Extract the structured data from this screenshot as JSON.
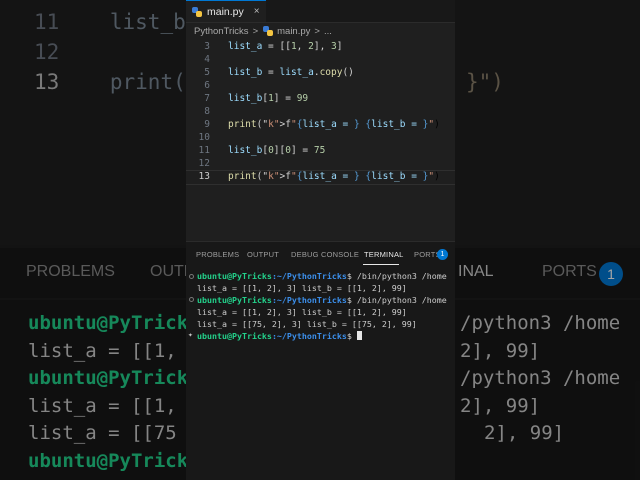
{
  "editor": {
    "tab_label": "main.py",
    "tab_close": "×",
    "breadcrumb": {
      "folder": "PythonTricks",
      "sep1": ">",
      "file": "main.py",
      "sep2": ">",
      "more": "..."
    },
    "lines": [
      {
        "num": "3",
        "code": "list_a = [[1, 2], 3]"
      },
      {
        "num": "4",
        "code": ""
      },
      {
        "num": "5",
        "code": "list_b = list_a.copy()"
      },
      {
        "num": "6",
        "code": ""
      },
      {
        "num": "7",
        "code": "list_b[1] = 99"
      },
      {
        "num": "8",
        "code": ""
      },
      {
        "num": "9",
        "code": "print(f\"{list_a = } {list_b = }\")"
      },
      {
        "num": "10",
        "code": ""
      },
      {
        "num": "11",
        "code": "list_b[0][0] = 75"
      },
      {
        "num": "12",
        "code": ""
      },
      {
        "num": "13",
        "code": "print(f\"{list_a = } {list_b = }\")"
      }
    ]
  },
  "panel": {
    "tabs": [
      "PROBLEMS",
      "OUTPUT",
      "DEBUG CONSOLE",
      "TERMINAL",
      "PORTS"
    ],
    "ports_badge": "1",
    "terminal": {
      "prompt_user": "ubuntu@PyTricks",
      "prompt_path": ":~/PythonTricks",
      "prompt_char": "$",
      "cmd1": " /bin/python3 /home",
      "out1": "list_a = [[1, 2], 3] list_b = [[1, 2], 99]",
      "cmd2": " /bin/python3 /home",
      "out2a": "list_a = [[1, 2], 3] list_b = [[1, 2], 99]",
      "out2b": "list_a = [[75, 2], 3] list_b = [[75, 2], 99]"
    }
  },
  "background": {
    "lines": [
      {
        "num": "11",
        "code": "list_b["
      },
      {
        "num": "12",
        "code": ""
      },
      {
        "num": "13",
        "code": "print(f"
      }
    ],
    "right_code": "}\")",
    "tab_problems": "PROBLEMS",
    "tab_output": "OUTP",
    "tab_terminal": "INAL",
    "tab_ports": "PORTS",
    "ports_badge": "1",
    "term_lines": [
      "ubuntu@PyTricks",
      "list_a = [[1,",
      "ubuntu@PyTricks",
      "list_a = [[1,",
      "list_a = [[75",
      "ubuntu@PyTrick"
    ],
    "term_right": [
      "/python3 /home",
      "2], 99]",
      "/python3 /home",
      "2], 99]",
      "2], 99]"
    ]
  },
  "colors": {
    "accent": "#0078d4",
    "prompt_user": "#23d18b",
    "prompt_path": "#3b8eea"
  },
  "icons": [
    "python-file-icon",
    "close-icon",
    "terminal-status-dot",
    "sparkle-icon"
  ]
}
